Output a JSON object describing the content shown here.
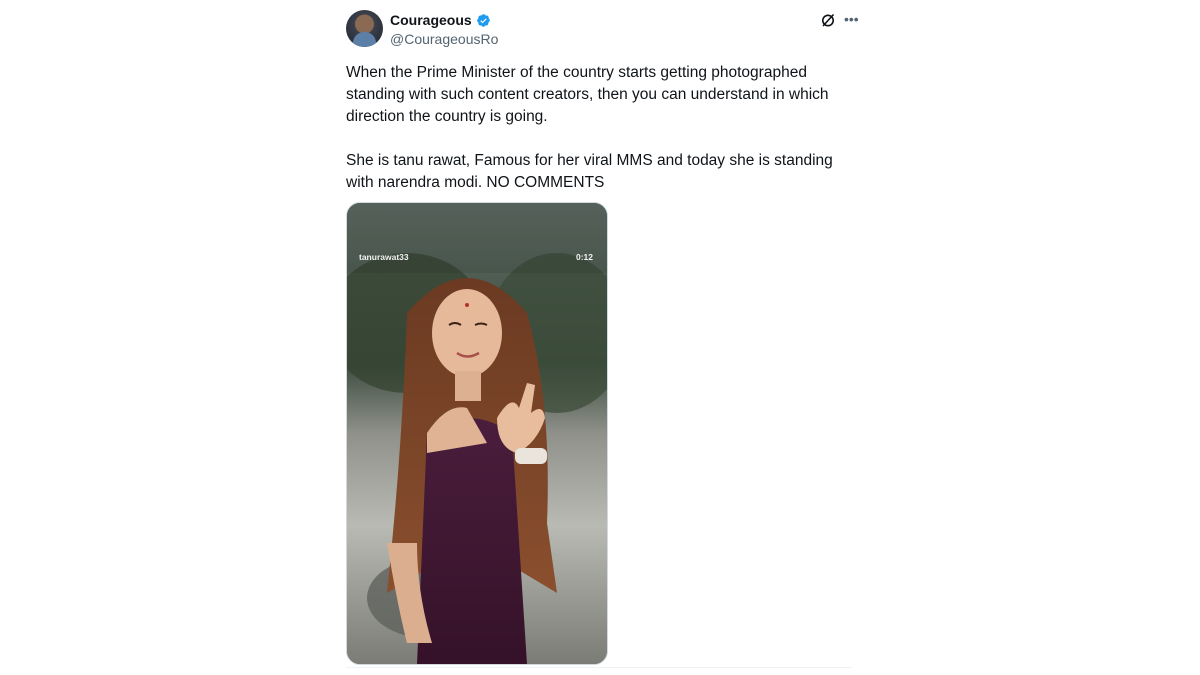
{
  "author": {
    "display_name": "Courageous",
    "handle": "@CourageousRo",
    "verified": true,
    "avatar_icon": "avatar-image"
  },
  "actions": {
    "grok_icon": "grok-icon",
    "more_icon": "more-horizontal-icon"
  },
  "tweet": {
    "paragraphs": [
      "When the Prime Minister of the country starts getting photographed standing with such content creators, then you can understand in which direction the country is going.",
      "She is tanu rawat, Famous for her viral MMS and today she is standing with narendra modi. NO COMMENTS"
    ]
  },
  "media": {
    "type": "video",
    "username_overlay": "tanurawat33",
    "duration": "0:12"
  },
  "colors": {
    "accent": "#1d9bf0",
    "text": "#0f1419",
    "secondary": "#536471"
  }
}
